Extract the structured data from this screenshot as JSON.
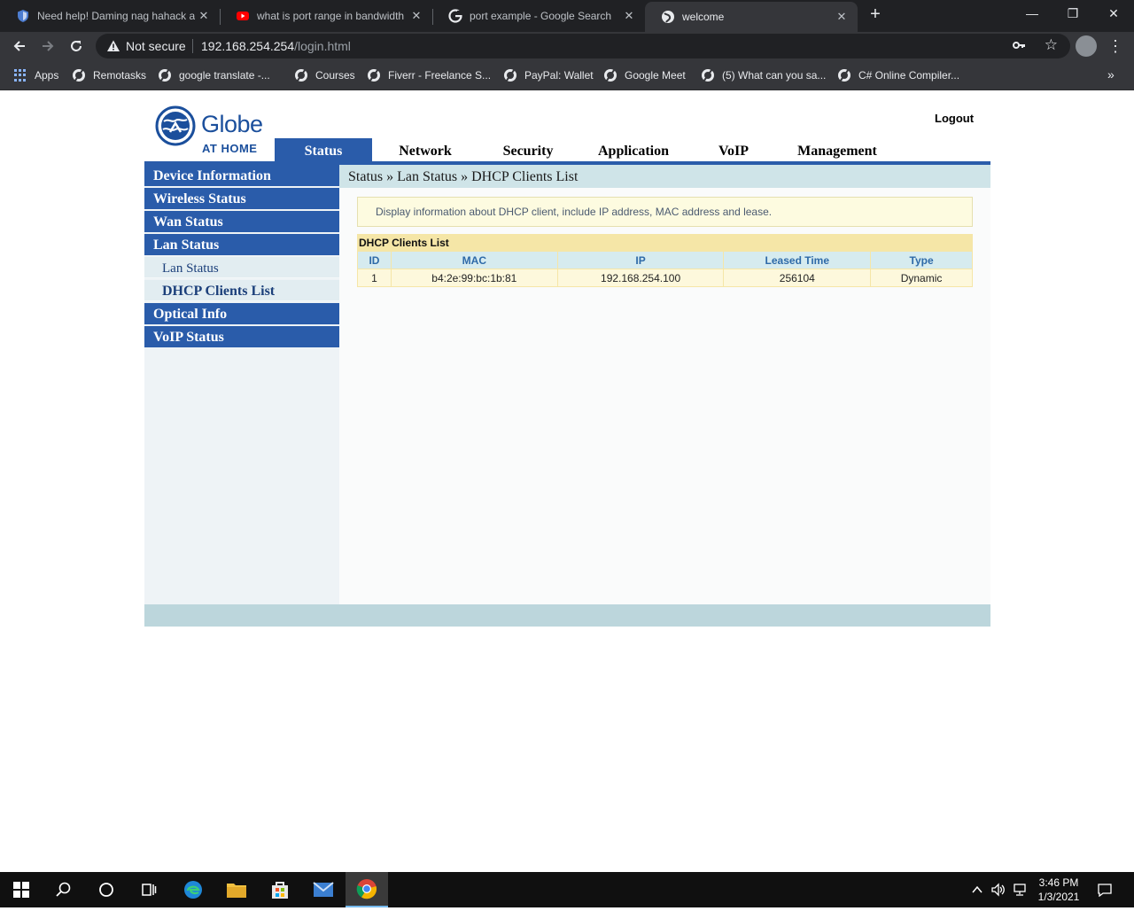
{
  "browser": {
    "tabs": [
      {
        "title": "Need help! Daming nag hahack a",
        "icon": "shield-favicon-icon",
        "active": false
      },
      {
        "title": "what is port range in bandwidth",
        "icon": "youtube-favicon-icon",
        "active": false
      },
      {
        "title": "port example - Google Search",
        "icon": "google-favicon-icon",
        "active": false
      },
      {
        "title": "welcome",
        "icon": "globe-favicon-icon",
        "active": true
      }
    ],
    "new_tab": "+",
    "window_controls": {
      "minimize": "—",
      "restore": "❐",
      "close": "✕"
    },
    "security_label": "Not secure",
    "url_host": "192.168.254.254",
    "url_path": "/login.html",
    "bookmarks": [
      {
        "label": "Apps",
        "icon": "apps-grid-icon"
      },
      {
        "label": "Remotasks",
        "icon": "globe-icon"
      },
      {
        "label": "google translate -...",
        "icon": "globe-icon"
      },
      {
        "label": "Courses",
        "icon": "globe-icon"
      },
      {
        "label": "Fiverr - Freelance S...",
        "icon": "globe-icon"
      },
      {
        "label": "PayPal: Wallet",
        "icon": "globe-icon"
      },
      {
        "label": "Google Meet",
        "icon": "globe-icon"
      },
      {
        "label": "(5) What can you sa...",
        "icon": "globe-icon"
      },
      {
        "label": "C# Online Compiler...",
        "icon": "globe-icon"
      }
    ],
    "bookmarks_more": "»"
  },
  "router": {
    "brand": "Globe",
    "brand_sub": "AT HOME",
    "logout": "Logout",
    "main_tabs": [
      {
        "label": "Status",
        "active": true
      },
      {
        "label": "Network",
        "active": false
      },
      {
        "label": "Security",
        "active": false
      },
      {
        "label": "Application",
        "active": false
      },
      {
        "label": "VoIP",
        "active": false
      },
      {
        "label": "Management",
        "active": false
      }
    ],
    "sidebar": [
      {
        "label": "Device Information",
        "type": "section"
      },
      {
        "label": "Wireless Status",
        "type": "section"
      },
      {
        "label": "Wan Status",
        "type": "section"
      },
      {
        "label": "Lan Status",
        "type": "section"
      },
      {
        "label": "Lan Status",
        "type": "sub"
      },
      {
        "label": "DHCP Clients List",
        "type": "sub",
        "current": true
      },
      {
        "label": "Optical Info",
        "type": "section"
      },
      {
        "label": "VoIP Status",
        "type": "section"
      }
    ],
    "breadcrumb": "Status » Lan Status » DHCP Clients List",
    "info_text": "Display information about DHCP client, include IP address, MAC address and lease.",
    "table_title": "DHCP Clients List",
    "table_headers": [
      "ID",
      "MAC",
      "IP",
      "Leased Time",
      "Type"
    ],
    "table_rows": [
      [
        "1",
        "b4:2e:99:bc:1b:81",
        "192.168.254.100",
        "256104",
        "Dynamic"
      ]
    ]
  },
  "taskbar": {
    "time": "3:46 PM",
    "date": "1/3/2021",
    "apps": [
      "start-icon",
      "search-icon",
      "cortana-icon",
      "task-view-icon",
      "edge-icon",
      "file-explorer-icon",
      "store-icon",
      "mail-icon",
      "chrome-icon"
    ]
  },
  "colors": {
    "nav_blue": "#2a5caa",
    "breadcrumb_bg": "#cfe4e8",
    "table_header_text": "#2e6aa8",
    "table_title_bg": "#f5e6a7",
    "footer_bg": "#bcd6dc"
  }
}
